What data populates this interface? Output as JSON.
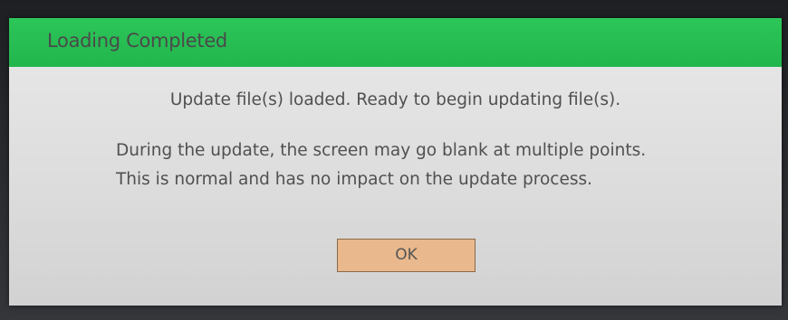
{
  "dialog": {
    "title": "Loading Completed",
    "headline": "Update file(s) loaded. Ready to begin updating file(s).",
    "body_lines": [
      "During the update, the screen may go blank at multiple points.",
      "This is normal and has no impact on the update process."
    ],
    "ok_label": "OK"
  },
  "colors": {
    "title_bar": "#28c056",
    "dialog_background": "#e2e2e2",
    "button_background": "#e9b88c",
    "button_border": "#8a6a4a"
  }
}
